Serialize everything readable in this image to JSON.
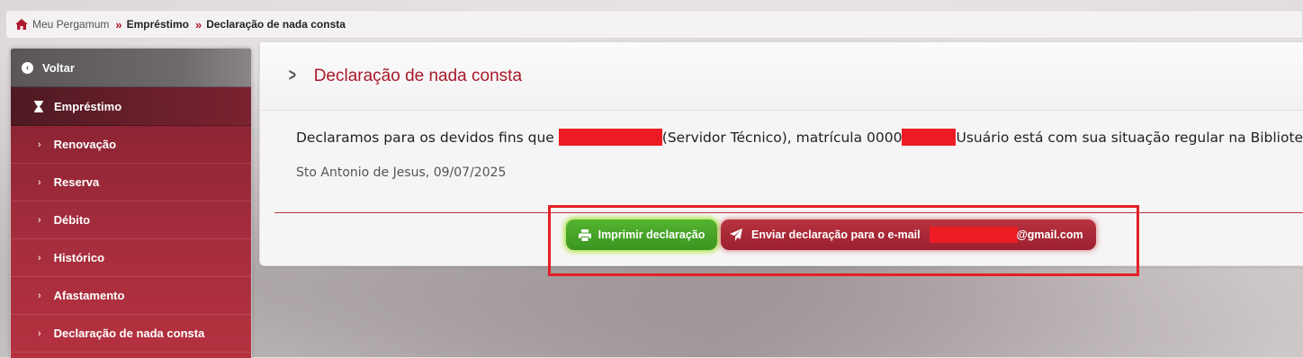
{
  "breadcrumb": {
    "home": "Meu Pergamum",
    "level1": "Empréstimo",
    "current": "Declaração de nada consta"
  },
  "sidebar": {
    "back_label": "Voltar",
    "section_label": "Empréstimo",
    "items": [
      {
        "label": "Renovação"
      },
      {
        "label": "Reserva"
      },
      {
        "label": "Débito"
      },
      {
        "label": "Histórico"
      },
      {
        "label": "Afastamento"
      },
      {
        "label": "Declaração de nada consta"
      }
    ]
  },
  "main": {
    "title": "Declaração de nada consta",
    "declaration": {
      "prefix": "Declaramos para os devidos fins que ",
      "role": "(Servidor Técnico), matrícula 0000",
      "suffix": "Usuário está com sua situação regular na Biblioteca"
    },
    "place_date": "Sto Antonio de Jesus, 09/07/2025",
    "print_button": "Imprimir declaração",
    "email_button_prefix": "Enviar declaração para o e-mail",
    "email_button_suffix": "@gmail.com"
  },
  "icons": {
    "home": "home-icon",
    "back": "arrow-left-circle-icon",
    "section": "hourglass-icon",
    "print": "printer-icon",
    "send": "paper-plane-icon"
  },
  "colors": {
    "accent": "#a8192b",
    "print_button": "#3a9521",
    "email_button": "#9c2030",
    "redaction": "#ed1c24"
  }
}
